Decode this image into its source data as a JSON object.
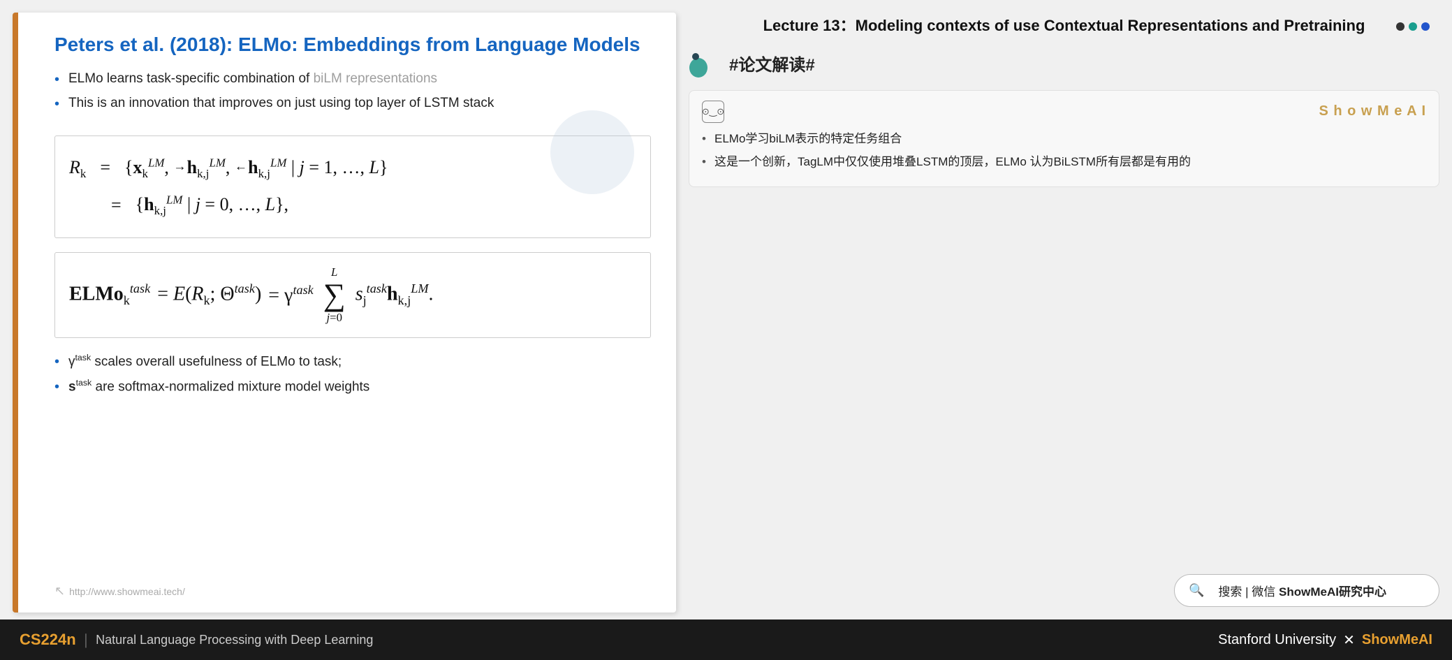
{
  "slide": {
    "title": "Peters et al. (2018): ELMo: Embeddings from Language Models",
    "bullet1": "ELMo learns task-specific combination of biLM representations",
    "bullet2": "This is an innovation that improves on just using top layer of LSTM stack",
    "formula_rk_label": "R",
    "formula_equals": "=",
    "formula_set1": "{x",
    "formula_set2": ", h",
    "formula_set3": ", h",
    "formula_tail": "| j = 1, …, L}",
    "formula_line2": "= {h",
    "formula_line2_tail": "| j = 0, …, L},",
    "elmo_formula_text": "ELMo",
    "elmo_formula_full": "ELMo_k^task = E(R_k; Θ^task) = γ^task Σ s_j^task h_{k,j}^LM",
    "bullet3_gamma": "γ^task scales overall usefulness of ELMo to task;",
    "bullet4_s": "s^task are softmax-normalized mixture model weights",
    "url": "http://www.showmeai.tech/"
  },
  "right": {
    "lecture_title": "Lecture 13：Modeling contexts of use Contextual Representations and Pretraining",
    "tag_text": "#论文解读#",
    "showmeai_brand": "S h o w M e A I",
    "card_bullet1": "ELMo学习biLM表示的特定任务组合",
    "card_bullet2": "这是一个创新，TagLM中仅仅使用堆叠LSTM的顶层，ELMo 认为BiLSTM所有层都是有用的",
    "search_label": "搜索 | 微信",
    "search_brand": "ShowMeAI研究中心"
  },
  "bottom": {
    "cs224n": "CS224n",
    "divider": "|",
    "subtitle": "Natural Language Processing with Deep Learning",
    "stanford": "Stanford University",
    "x": "✕",
    "showmeai": "ShowMeAI"
  },
  "dots": [
    {
      "color": "#333"
    },
    {
      "color": "#1a9e8e"
    },
    {
      "color": "#2255cc"
    }
  ]
}
